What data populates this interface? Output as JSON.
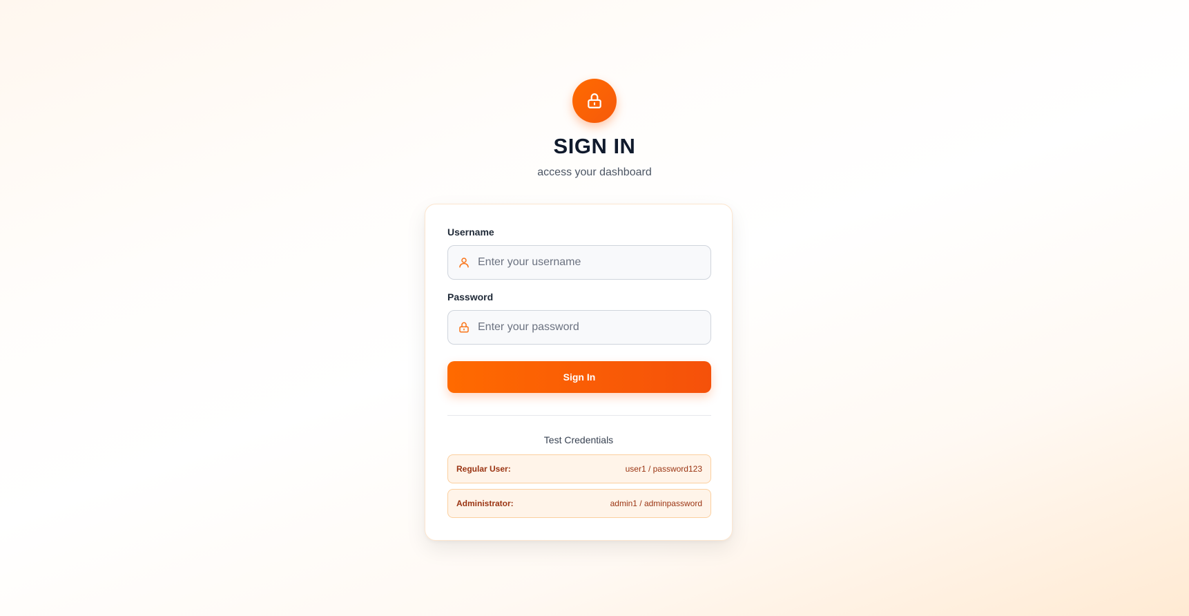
{
  "header": {
    "title": "SIGN IN",
    "subtitle": "access your dashboard"
  },
  "form": {
    "username": {
      "label": "Username",
      "placeholder": "Enter your username",
      "value": ""
    },
    "password": {
      "label": "Password",
      "placeholder": "Enter your password",
      "value": ""
    },
    "submit_label": "Sign In"
  },
  "credentials": {
    "title": "Test Credentials",
    "items": [
      {
        "role": "Regular User:",
        "value": "user1 / password123"
      },
      {
        "role": "Administrator:",
        "value": "admin1 / adminpassword"
      }
    ]
  },
  "icons": {
    "logo": "lock-icon",
    "username": "user-icon",
    "password": "lock-icon"
  },
  "colors": {
    "accent": "#ff6a00",
    "accent_dark": "#f5510a",
    "title": "#101a2c",
    "credential_text": "#9a3412",
    "credential_bg": "#fff4e9",
    "credential_border": "#fbcf9e"
  }
}
